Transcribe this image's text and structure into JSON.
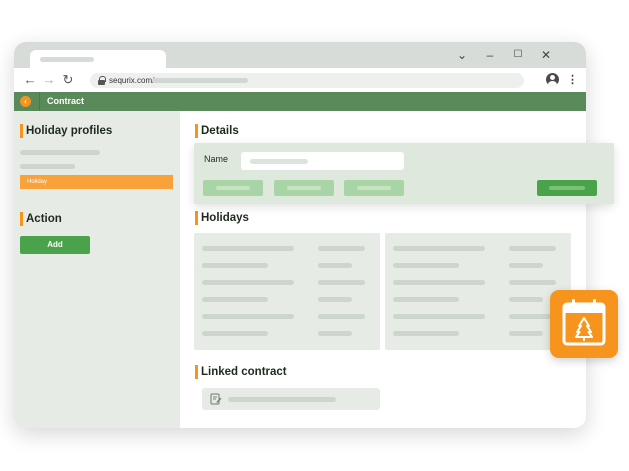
{
  "browser": {
    "url": "sequrix.com/",
    "window_controls": {
      "dropdown": "⌄",
      "minimize": "–",
      "maximize": "☐",
      "close": "✕"
    },
    "nav": {
      "back": "←",
      "forward": "→",
      "reload": "↻"
    },
    "menu": "⋮"
  },
  "app": {
    "title": "Contract",
    "back_icon": "arrow-left-icon"
  },
  "sidebar": {
    "profiles_title": "Holiday profiles",
    "selected_item_label": "Holiday",
    "action_title": "Action",
    "add_label": "Add"
  },
  "main": {
    "details_title": "Details",
    "name_label": "Name",
    "holidays_title": "Holidays",
    "linked_title": "Linked contract"
  },
  "colors": {
    "accent_orange": "#f7941d",
    "header_green": "#5a8a5a",
    "button_green": "#4aa34a",
    "panel_gray_green": "#e6ebe5"
  },
  "icons": {
    "calendar_tile": "calendar-tree-icon",
    "linked_doc": "document-edit-icon"
  }
}
